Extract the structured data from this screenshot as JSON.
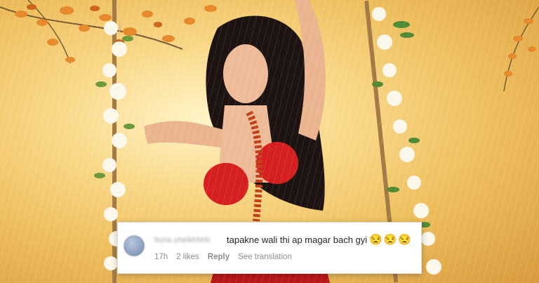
{
  "scene": {
    "background_colors": {
      "sun": "#fff4c8",
      "mid": "#eebf5e",
      "edge": "#d99a3c"
    }
  },
  "comment": {
    "username": "fozia.sheikhhhh",
    "text": "tapakne wali thi ap magar bach gyi",
    "emojis": "😒😒😒",
    "time": "17h",
    "likes": "2 likes",
    "reply_label": "Reply",
    "translation_label": "See translation",
    "colors": {
      "card_bg": "#ffffff",
      "text": "#262626",
      "meta": "#8e8e8e"
    }
  }
}
